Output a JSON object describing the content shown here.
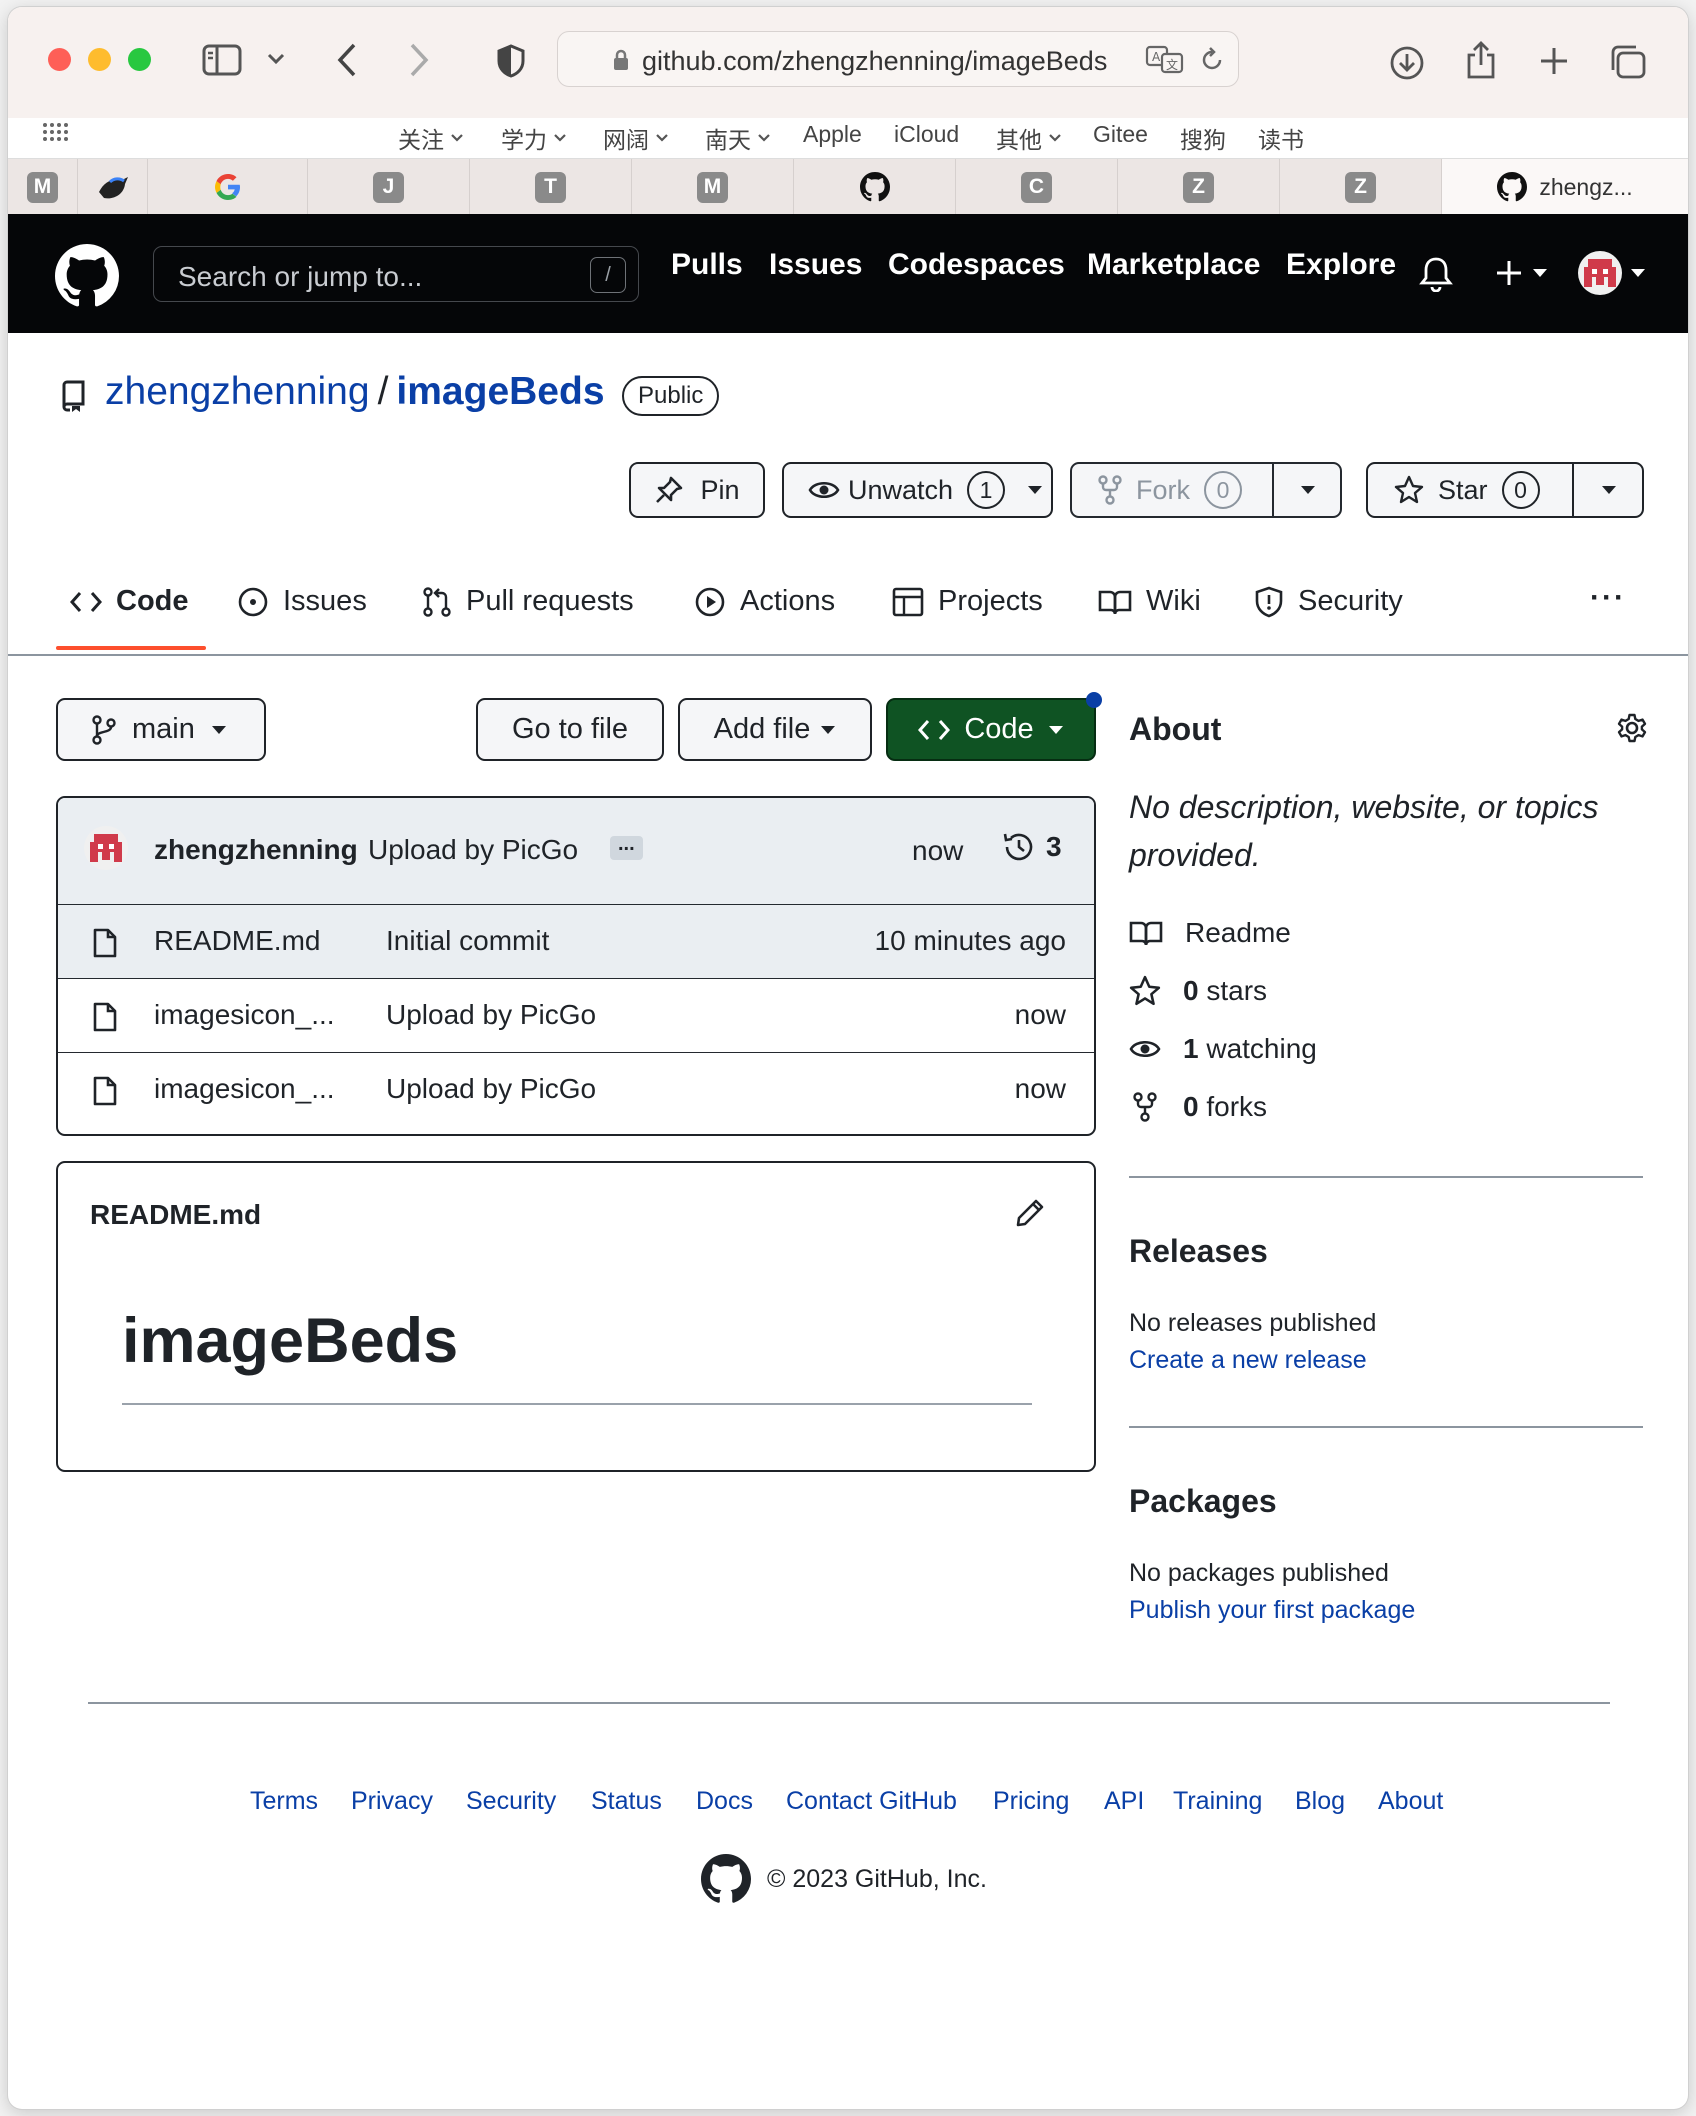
{
  "browser": {
    "url": "github.com/zhengzhenning/imageBeds",
    "bookmarks": [
      "关注",
      "学力",
      "网阔",
      "南天",
      "Apple",
      "iCloud",
      "其他",
      "Gitee",
      "搜狗",
      "读书"
    ],
    "tabs": [
      {
        "favicon": "M"
      },
      {
        "favicon": "bird"
      },
      {
        "favicon": "G"
      },
      {
        "favicon": "J"
      },
      {
        "favicon": "T"
      },
      {
        "favicon": "M"
      },
      {
        "favicon": "github"
      },
      {
        "favicon": "C"
      },
      {
        "favicon": "Z"
      },
      {
        "favicon": "Z"
      },
      {
        "favicon": "github",
        "label": "zhengz..."
      }
    ]
  },
  "header": {
    "search_placeholder": "Search or jump to...",
    "search_key": "/",
    "nav": [
      "Pulls",
      "Issues",
      "Codespaces",
      "Marketplace",
      "Explore"
    ]
  },
  "repo": {
    "owner": "zhengzhenning",
    "sep": "/",
    "name": "imageBeds",
    "visibility": "Public",
    "pin_label": "Pin",
    "unwatch_label": "Unwatch",
    "watch_count": "1",
    "fork_label": "Fork",
    "fork_count": "0",
    "star_label": "Star",
    "star_count": "0",
    "tabs": [
      "Code",
      "Issues",
      "Pull requests",
      "Actions",
      "Projects",
      "Wiki",
      "Security"
    ],
    "more": "···"
  },
  "files": {
    "branch": "main",
    "goto_label": "Go to file",
    "add_label": "Add file",
    "code_label": "Code",
    "commit": {
      "author": "zhengzhenning",
      "message": "Upload by PicGo",
      "dots": "...",
      "time": "now",
      "count": "3"
    },
    "rows": [
      {
        "name": "README.md",
        "message": "Initial commit",
        "time": "10 minutes ago"
      },
      {
        "name": "imagesicon_...",
        "message": "Upload by PicGo",
        "time": "now"
      },
      {
        "name": "imagesicon_...",
        "message": "Upload by PicGo",
        "time": "now"
      }
    ]
  },
  "readme": {
    "filename": "README.md",
    "heading": "imageBeds"
  },
  "about": {
    "title": "About",
    "description": "No description, website, or topics provided.",
    "readme": "Readme",
    "stars_n": "0",
    "stars": "stars",
    "watching_n": "1",
    "watching": "watching",
    "forks_n": "0",
    "forks": "forks"
  },
  "releases": {
    "title": "Releases",
    "none": "No releases published",
    "link": "Create a new release"
  },
  "packages": {
    "title": "Packages",
    "none": "No packages published",
    "link": "Publish your first package"
  },
  "footer": {
    "links": [
      "Terms",
      "Privacy",
      "Security",
      "Status",
      "Docs",
      "Contact GitHub",
      "Pricing",
      "API",
      "Training",
      "Blog",
      "About"
    ],
    "copyright": "© 2023 GitHub, Inc."
  },
  "colors": {
    "link": "#0a3fa6",
    "code_button": "#0f5323",
    "accent_underline": "#fd4f2d",
    "header_bg": "#050608"
  }
}
